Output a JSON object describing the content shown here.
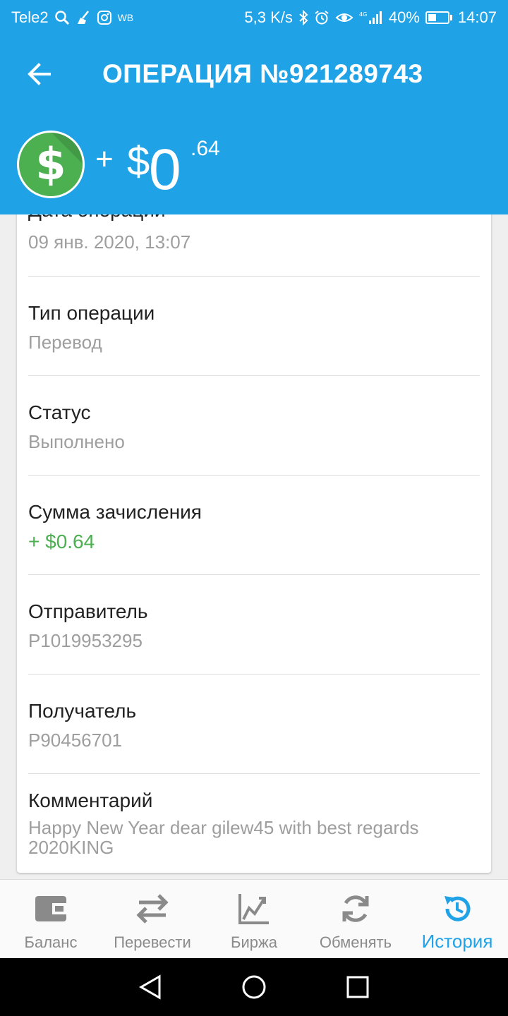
{
  "status_bar": {
    "carrier": "Tele2",
    "extra": "WB",
    "speed": "5,3 K/s",
    "network": "4G",
    "battery": "40%",
    "time": "14:07"
  },
  "toolbar": {
    "title": "ОПЕРАЦИЯ №921289743"
  },
  "amount": {
    "sign": "+",
    "currency": "$",
    "integer": "0",
    "cents": ".64",
    "icon_color": "#4caf50"
  },
  "details": [
    {
      "label": "Дата операции",
      "value": "09 янв. 2020, 13:07"
    },
    {
      "label": "Тип операции",
      "value": "Перевод"
    },
    {
      "label": "Статус",
      "value": "Выполнено"
    },
    {
      "label": "Сумма зачисления",
      "value": "+ $0.64"
    },
    {
      "label": "Отправитель",
      "value": "P1019953295"
    },
    {
      "label": "Получатель",
      "value": "P90456701"
    },
    {
      "label": "Комментарий",
      "value": "Happy New Year dear gilew45 with best regards 2020KING"
    }
  ],
  "bottom_nav": [
    {
      "label": "Баланс",
      "icon": "wallet-icon"
    },
    {
      "label": "Перевести",
      "icon": "transfer-icon"
    },
    {
      "label": "Биржа",
      "icon": "chart-icon"
    },
    {
      "label": "Обменять",
      "icon": "exchange-icon"
    },
    {
      "label": "История",
      "icon": "history-icon",
      "active": true
    }
  ],
  "colors": {
    "primary": "#1fa2e6",
    "success": "#4caf50",
    "muted": "#9e9e9e"
  }
}
